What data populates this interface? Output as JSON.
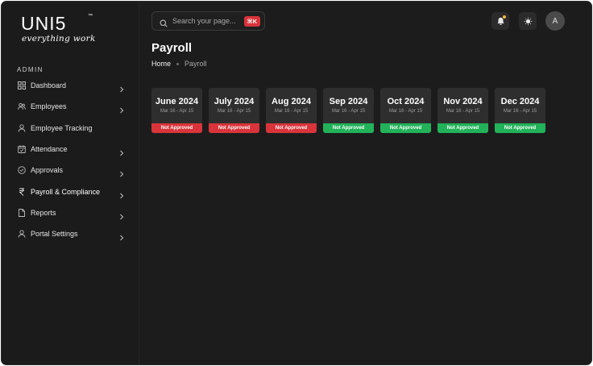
{
  "brand": {
    "wordmark": "UNI5",
    "trademark": "™",
    "tagline": "everything work"
  },
  "sidebar": {
    "section_label": "ADMIN",
    "items": [
      {
        "label": "Dashboard",
        "icon": "dashboard-grid-icon",
        "has_chevron": true
      },
      {
        "label": "Employees",
        "icon": "users-icon",
        "has_chevron": true
      },
      {
        "label": "Employee Tracking",
        "icon": "user-icon",
        "has_chevron": false
      },
      {
        "label": "Attendance",
        "icon": "calendar-check-icon",
        "has_chevron": true
      },
      {
        "label": "Approvals",
        "icon": "check-circle-icon",
        "has_chevron": true
      },
      {
        "label": "Payroll & Compliance",
        "icon": "rupee-icon",
        "has_chevron": true,
        "active": true
      },
      {
        "label": "Reports",
        "icon": "document-icon",
        "has_chevron": true
      },
      {
        "label": "Portal Settings",
        "icon": "user-gear-icon",
        "has_chevron": true
      }
    ]
  },
  "topbar": {
    "search_placeholder": "Search your page...",
    "search_shortcut": "⌘K",
    "avatar_initial": "A",
    "notification_dot_color": "#f1b541"
  },
  "page": {
    "title": "Payroll",
    "breadcrumb": {
      "home": "Home",
      "current": "Payroll"
    }
  },
  "payroll_cards": [
    {
      "month": "June 2024",
      "range": "Mar 16 - Apr 15",
      "status": "Not Approved",
      "status_color": "#d9343a"
    },
    {
      "month": "July 2024",
      "range": "Mar 16 - Apr 15",
      "status": "Not Approved",
      "status_color": "#d9343a"
    },
    {
      "month": "Aug 2024",
      "range": "Mar 16 - Apr 15",
      "status": "Not Approved",
      "status_color": "#d9343a"
    },
    {
      "month": "Sep 2024",
      "range": "Mar 16 - Apr 15",
      "status": "Not Approved",
      "status_color": "#22b25a"
    },
    {
      "month": "Oct 2024",
      "range": "Mar 16 - Apr 15",
      "status": "Not Approved",
      "status_color": "#22b25a"
    },
    {
      "month": "Nov 2024",
      "range": "Mar 16 - Apr 15",
      "status": "Not Approved",
      "status_color": "#22b25a"
    },
    {
      "month": "Dec 2024",
      "range": "Mar 16 - Apr 15",
      "status": "Not Approved",
      "status_color": "#22b25a"
    }
  ],
  "colors": {
    "background": "#1c1c1c",
    "card": "#2e2e2e",
    "accent_red": "#d9343a",
    "accent_green": "#22b25a"
  }
}
